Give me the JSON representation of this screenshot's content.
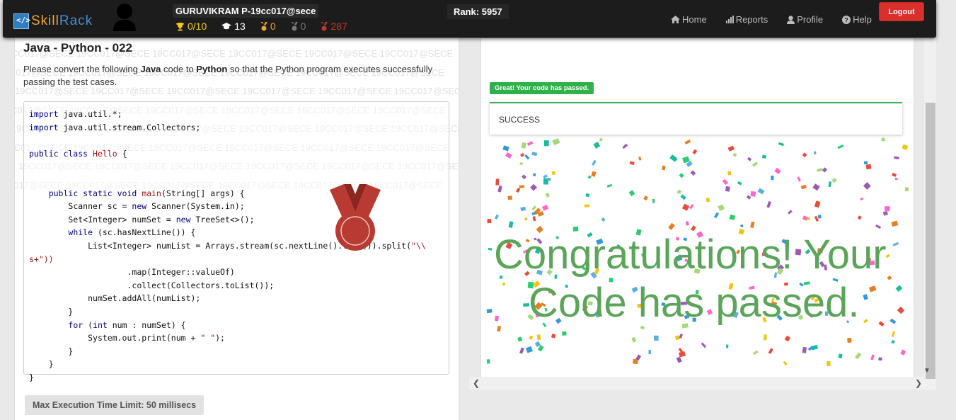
{
  "brand": {
    "logo_prefix": "Skill",
    "logo_suffix": "Rack"
  },
  "user": {
    "name": "GURUVIKRAM P-19cc017@sece"
  },
  "stats": {
    "trophy": "0/10",
    "courses": "13",
    "gold": "0",
    "silver": "0",
    "bronze": "287"
  },
  "rank": "Rank: 5957",
  "nav": {
    "home": "Home",
    "reports": "Reports",
    "profile": "Profile",
    "help": "Help",
    "logout": "Logout"
  },
  "colors": {
    "trophy": "#f5c518",
    "gold": "#f0a23a",
    "silver": "#777777",
    "bronze": "#c0392b",
    "success": "#2fb14a",
    "congrats": "#5aa55a"
  },
  "problem": {
    "title": "Java - Python - 022",
    "desc_1": "Please convert the following ",
    "desc_lang1": "Java",
    "desc_2": " code to ",
    "desc_lang2": "Python",
    "desc_3": " so that the Python program executes successfully passing the test cases.",
    "watermark": "19CC017@SECE 19CC017@SECE 19CC017@SECE 19CC017@SECE 19CC017@SECE 19CC017@SECE",
    "limit": "Max Execution Time Limit: 50 millisecs"
  },
  "code": {
    "l1": "java.util.*;",
    "l2": "java.util.stream.Collectors;",
    "l3": "Hello {",
    "l4": "(String[] args) {",
    "l5": "Scanner sc = ",
    "l5b": "Scanner(System.in);",
    "l6": "Set<Integer> numSet = ",
    "l6b": "TreeSet<>();",
    "l7": "(sc.hasNextLine()) {",
    "l8": "List<Integer> numList = Arrays.stream(sc.nextLine().trim()).split(",
    "l8s": "\"\\\\",
    "l9": "s+\"))",
    "l10": ".map(Integer::valueOf)",
    "l11": ".collect(Collectors.toList());",
    "l12": "numSet.addAll(numList);",
    "l13": "}",
    "l14a": " num : numSet) {",
    "l15": "System.out.print(num + ",
    "l15s": "\" \"",
    "l15e": ");",
    "l16": "}",
    "l17": "}",
    "l18": "}"
  },
  "result": {
    "badge": "Great! Your code has passed.",
    "status": "SUCCESS",
    "congrats_1": "Congratulations! Your",
    "congrats_2": "Code has passed."
  }
}
